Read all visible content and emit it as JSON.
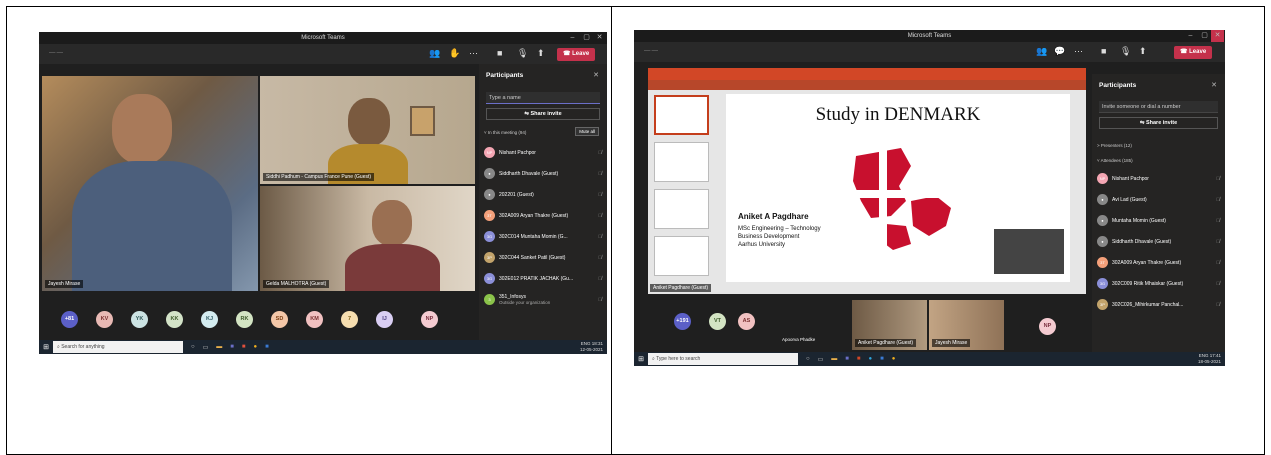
{
  "left": {
    "app_title": "Microsoft Teams",
    "leave_label": "Leave",
    "tiles": [
      {
        "name": "Jayesh Mirase"
      },
      {
        "name": "Siddhi Padhum - Campus France Pune (Guest)"
      },
      {
        "name": "Gelda MALHOTRA (Guest)"
      }
    ],
    "avatars": [
      {
        "label": "+81",
        "color": "#5b5fc7",
        "text": "#fff"
      },
      {
        "label": "KV",
        "color": "#e8b9b4",
        "text": "#7a2f2f"
      },
      {
        "label": "YK",
        "color": "#cce3e3",
        "text": "#2f5757"
      },
      {
        "label": "KK",
        "color": "#d3e3c8",
        "text": "#3d5a2a"
      },
      {
        "label": "KJ",
        "color": "#d4ecf0",
        "text": "#2f5a63"
      },
      {
        "label": "RK",
        "color": "#d3e4c3",
        "text": "#3d5a2a"
      },
      {
        "label": "SD",
        "color": "#f4c7a8",
        "text": "#7b3d12"
      },
      {
        "label": "KM",
        "color": "#f1c1c1",
        "text": "#7a2f2f"
      },
      {
        "label": "7",
        "color": "#f6deb0",
        "text": "#7a5a12"
      },
      {
        "label": "IJ",
        "color": "#d9cef3",
        "text": "#4b3d80"
      },
      {
        "label": "NP",
        "color": "#f4cbd1",
        "text": "#7a2f3f"
      }
    ],
    "panel": {
      "title": "Participants",
      "search_placeholder": "Type a name",
      "share_invite": "Share invite",
      "section": "In this meeting (94)",
      "mute_all": "Mute all",
      "people": [
        {
          "name": "Nishant Pachpor",
          "initials": "NP",
          "color": "#f4a6b3"
        },
        {
          "name": "Siddharth Dhavale (Guest)",
          "initials": "",
          "color": "#888"
        },
        {
          "name": "202201 (Guest)",
          "initials": "",
          "color": "#888"
        },
        {
          "name": "302A009 Aryan Thakre (Guest)",
          "initials": "3T",
          "color": "#f4a07a"
        },
        {
          "name": "302C014 Muntaha Momin (G...",
          "initials": "3G",
          "color": "#8b8fd8"
        },
        {
          "name": "302C044 Sanket Patil (Guest)",
          "initials": "3P",
          "color": "#c2a36b"
        },
        {
          "name": "302E012 PRATIK JACHAK (Gu...",
          "initials": "3G",
          "color": "#8b8fd8"
        },
        {
          "name": "351_Infosys",
          "initials": "3",
          "color": "#8bc34a"
        }
      ],
      "external_note": "Outside your organization"
    },
    "taskbar": {
      "search": "Search for anything",
      "time": "18:31",
      "date": "12-05-2021",
      "lang": "ENG"
    }
  },
  "right": {
    "app_title": "Microsoft Teams",
    "leave_label": "Leave",
    "slide": {
      "title": "Study in DENMARK",
      "presenter": "Aniket A Pagdhare",
      "line1": "MSc Engineering – Technology",
      "line2": "Business Development",
      "line3": "Aarhus University"
    },
    "presenter_tag": "Aniket Pagdhare (Guest)",
    "avatars": [
      {
        "label": "+191",
        "color": "#5b5fc7",
        "text": "#fff"
      },
      {
        "label": "VT",
        "color": "#d3e4c3",
        "text": "#3d5a2a"
      },
      {
        "label": "AS",
        "color": "#f1c1c1",
        "text": "#7a2f2f"
      },
      {
        "label": "NP",
        "color": "#f4cbd1",
        "text": "#7a2f3f"
      }
    ],
    "video_names": [
      "Apoorva Phadke",
      "Aniket Pagdhare (Guest)",
      "Jayesh Mirase"
    ],
    "panel": {
      "title": "Participants",
      "search_placeholder": "Invite someone or dial a number",
      "share_invite": "Share invite",
      "presenters": "Presenters (12)",
      "attendees": "Attendees (185)",
      "people": [
        {
          "name": "Nishant Pachpor",
          "initials": "NP",
          "color": "#f4a6b3"
        },
        {
          "name": "Avi Lad (Guest)",
          "initials": "",
          "color": "#888"
        },
        {
          "name": "Muntaha Momin (Guest)",
          "initials": "",
          "color": "#888"
        },
        {
          "name": "Siddharth Dhavale (Guest)",
          "initials": "",
          "color": "#888"
        },
        {
          "name": "302A009 Aryan Thakre (Guest)",
          "initials": "3T",
          "color": "#f4a07a"
        },
        {
          "name": "302C009 Ritik Mhaiskar (Guest)",
          "initials": "3G",
          "color": "#8b8fd8"
        },
        {
          "name": "302C026_Mihirkumar Panchal...",
          "initials": "3P",
          "color": "#c2a36b"
        }
      ]
    },
    "taskbar": {
      "search": "Type here to search",
      "time": "17:41",
      "date": "18-05-2021",
      "lang": "ENG"
    }
  }
}
